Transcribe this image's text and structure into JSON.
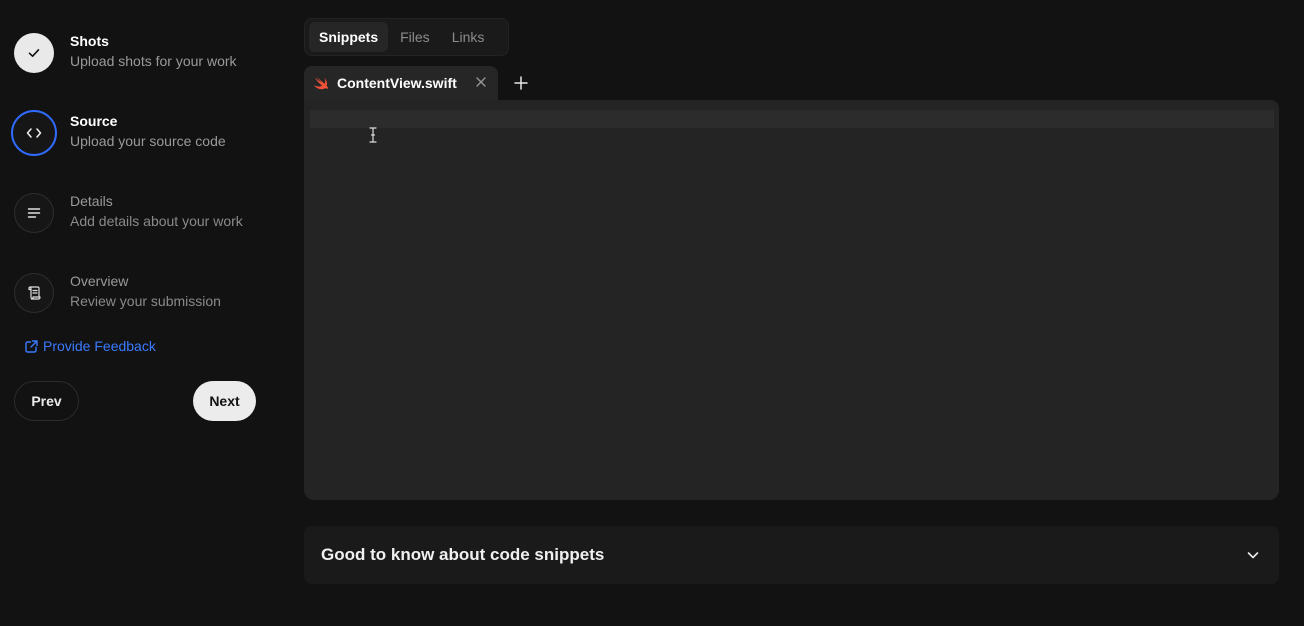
{
  "stepper": {
    "steps": [
      {
        "title": "Shots",
        "subtitle": "Upload shots for your work",
        "icon": "check-icon",
        "state": "done"
      },
      {
        "title": "Source",
        "subtitle": "Upload your source code",
        "icon": "code-icon",
        "state": "active"
      },
      {
        "title": "Details",
        "subtitle": "Add details about your work",
        "icon": "lines-icon",
        "state": "todo"
      },
      {
        "title": "Overview",
        "subtitle": "Review your submission",
        "icon": "scroll-icon",
        "state": "todo"
      }
    ],
    "feedback_label": "Provide Feedback",
    "prev_label": "Prev",
    "next_label": "Next"
  },
  "source_tabs": [
    {
      "label": "Snippets",
      "active": true
    },
    {
      "label": "Files",
      "active": false
    },
    {
      "label": "Links",
      "active": false
    }
  ],
  "editor": {
    "file_name": "ContentView.swift",
    "file_icon": "swift-icon",
    "content": ""
  },
  "info": {
    "title": "Good to know about code snippets"
  },
  "colors": {
    "background": "#121212",
    "accent_blue": "#2f6bff",
    "link_blue": "#3a7bff",
    "swift_orange": "#f05138",
    "editor_bg": "#242424"
  }
}
